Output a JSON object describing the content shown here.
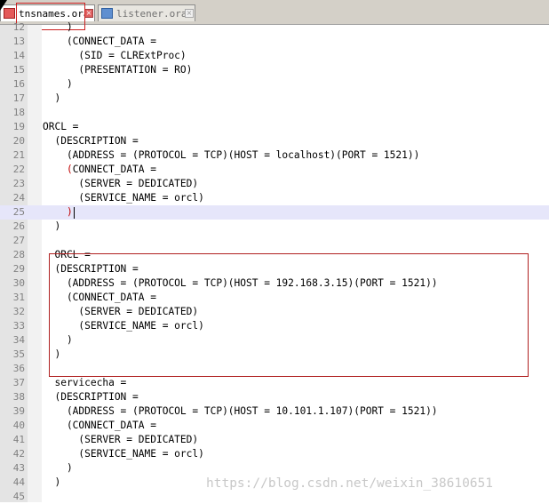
{
  "tabs": [
    {
      "label": "tnsnames.ora",
      "active": true
    },
    {
      "label": "listener.ora",
      "active": false
    }
  ],
  "colors": {
    "current_line": "#e6e6fa",
    "annotation_red": "#b02020",
    "gutter": "#e4e4e4"
  },
  "lines": [
    {
      "n": "12",
      "text": "    )"
    },
    {
      "n": "13",
      "text": "    (CONNECT_DATA ="
    },
    {
      "n": "14",
      "text": "      (SID = CLRExtProc)"
    },
    {
      "n": "15",
      "text": "      (PRESENTATION = RO)"
    },
    {
      "n": "16",
      "text": "    )"
    },
    {
      "n": "17",
      "text": "  )"
    },
    {
      "n": "18",
      "text": ""
    },
    {
      "n": "19",
      "text": "ORCL ="
    },
    {
      "n": "20",
      "text": "  (DESCRIPTION ="
    },
    {
      "n": "21",
      "text": "    (ADDRESS = (PROTOCOL = TCP)(HOST = localhost)(PORT = 1521))"
    },
    {
      "n": "22",
      "text": "    (CONNECT_DATA ="
    },
    {
      "n": "23",
      "text": "      (SERVER = DEDICATED)"
    },
    {
      "n": "24",
      "text": "      (SERVICE_NAME = orcl)"
    },
    {
      "n": "25",
      "text": "    )"
    },
    {
      "n": "26",
      "text": "  )"
    },
    {
      "n": "27",
      "text": ""
    },
    {
      "n": "28",
      "text": "  ORCL ="
    },
    {
      "n": "29",
      "text": "  (DESCRIPTION ="
    },
    {
      "n": "30",
      "text": "    (ADDRESS = (PROTOCOL = TCP)(HOST = 192.168.3.15)(PORT = 1521))"
    },
    {
      "n": "31",
      "text": "    (CONNECT_DATA ="
    },
    {
      "n": "32",
      "text": "      (SERVER = DEDICATED)"
    },
    {
      "n": "33",
      "text": "      (SERVICE_NAME = orcl)"
    },
    {
      "n": "34",
      "text": "    )"
    },
    {
      "n": "35",
      "text": "  )"
    },
    {
      "n": "36",
      "text": ""
    },
    {
      "n": "37",
      "text": "  servicecha ="
    },
    {
      "n": "38",
      "text": "  (DESCRIPTION ="
    },
    {
      "n": "39",
      "text": "    (ADDRESS = (PROTOCOL = TCP)(HOST = 10.101.1.107)(PORT = 1521))"
    },
    {
      "n": "40",
      "text": "    (CONNECT_DATA ="
    },
    {
      "n": "41",
      "text": "      (SERVER = DEDICATED)"
    },
    {
      "n": "42",
      "text": "      (SERVICE_NAME = orcl)"
    },
    {
      "n": "43",
      "text": "    )"
    },
    {
      "n": "44",
      "text": "  )"
    },
    {
      "n": "45",
      "text": ""
    }
  ],
  "watermark": "https://blog.csdn.net/weixin_38610651"
}
